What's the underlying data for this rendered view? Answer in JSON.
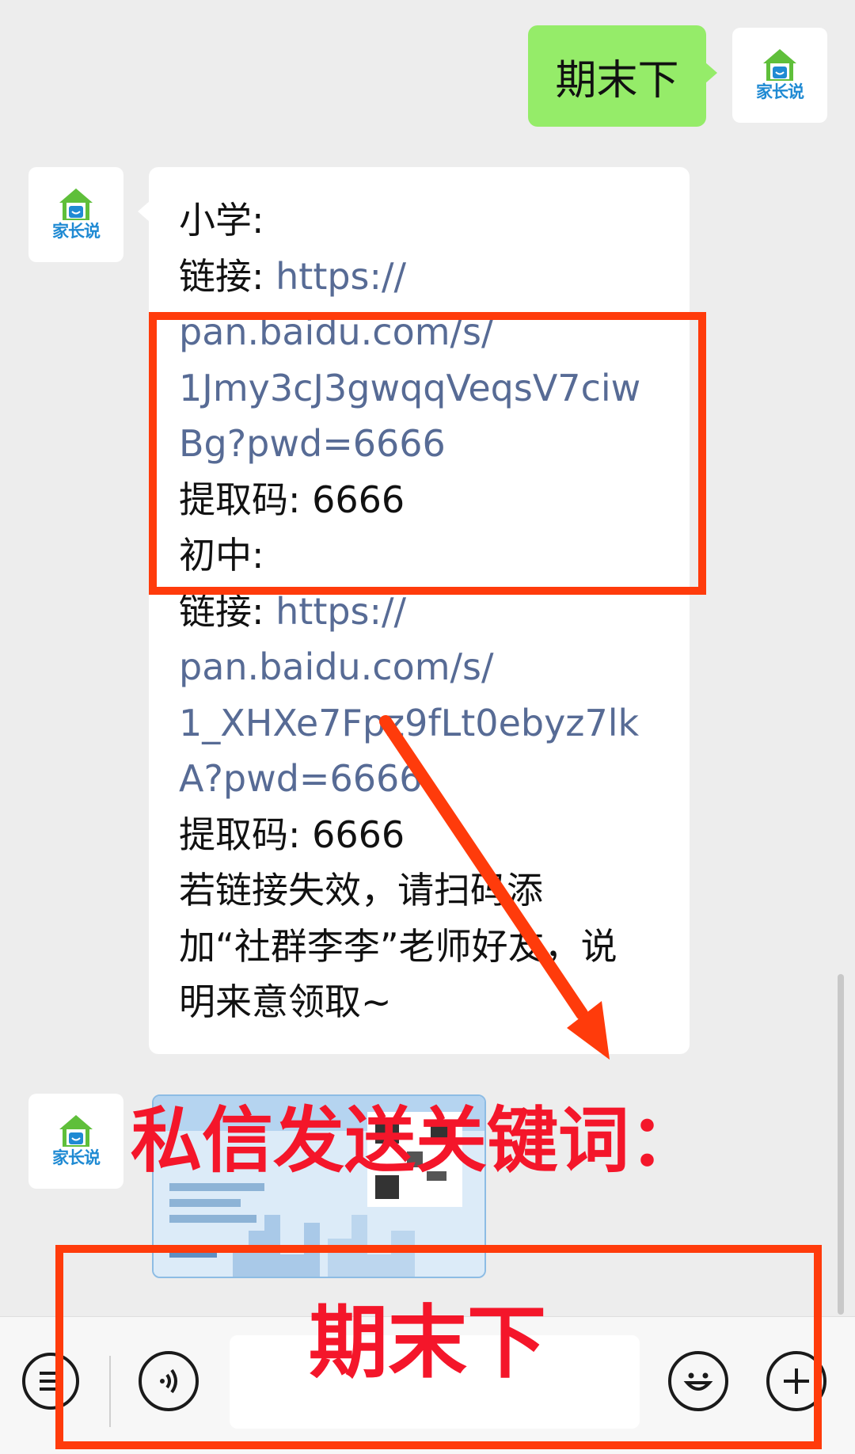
{
  "self_message": {
    "text": "期末下"
  },
  "avatar_brand": "家长说",
  "reply_message": {
    "lines": [
      {
        "label": "小学:",
        "link": ""
      },
      {
        "label": "链接: ",
        "link": "https://"
      },
      {
        "label": "",
        "link": "pan.baidu.com/s/"
      },
      {
        "label": "",
        "link": "1Jmy3cJ3gwqqVeqsV7ciw"
      },
      {
        "label": "",
        "link": "Bg?pwd=6666"
      },
      {
        "label": "提取码: 6666",
        "link": ""
      },
      {
        "label": "初中:",
        "link": ""
      },
      {
        "label": "链接: ",
        "link": "https://"
      },
      {
        "label": "",
        "link": "pan.baidu.com/s/"
      },
      {
        "label": "",
        "link": "1_XHXe7Fpz9fLt0ebyz7lk"
      },
      {
        "label": "",
        "link": "A?pwd=6666"
      },
      {
        "label": "提取码: 6666",
        "link": ""
      },
      {
        "label": "若链接失效，请扫码添",
        "link": ""
      },
      {
        "label": "加“社群李李”老师好友，说",
        "link": ""
      },
      {
        "label": "明来意领取~",
        "link": ""
      }
    ]
  },
  "overlay": {
    "instruction": "私信发送关键词：",
    "keyword": "期末下"
  },
  "icons": {
    "menu": "menu-list-icon",
    "voice": "voice-icon",
    "emoji": "emoji-icon",
    "plus": "plus-icon"
  },
  "colors": {
    "self_bubble": "#95ec69",
    "link": "#576b95",
    "annotation_red": "#ff3b0b",
    "overlay_text": "#f4162a"
  }
}
